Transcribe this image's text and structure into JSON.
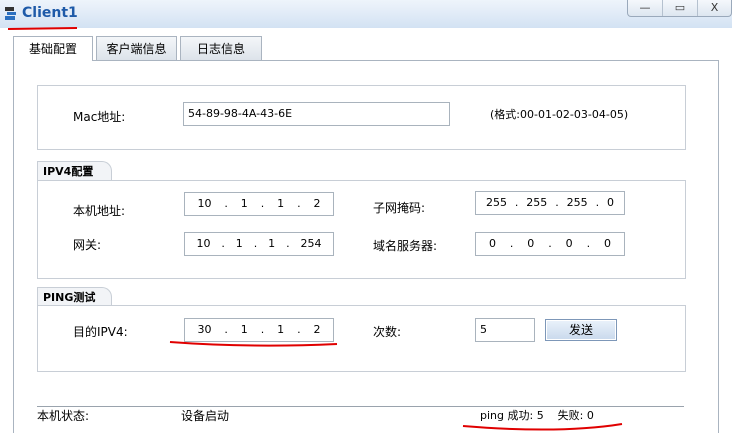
{
  "window": {
    "title": "Client1",
    "controls": {
      "minimize": "—",
      "maximize": "▭",
      "close": "X"
    }
  },
  "tabs": [
    {
      "label": "基础配置",
      "active": true
    },
    {
      "label": "客户端信息"
    },
    {
      "label": "日志信息"
    }
  ],
  "mac": {
    "label": "Mac地址:",
    "value": "54-89-98-4A-43-6E",
    "hint": "(格式:00-01-02-03-04-05)"
  },
  "ipv4": {
    "title": "IPV4配置",
    "local_label": "本机地址:",
    "local": [
      "10",
      "1",
      "1",
      "2"
    ],
    "mask_label": "子网掩码:",
    "mask": [
      "255",
      "255",
      "255",
      "0"
    ],
    "gw_label": "网关:",
    "gw": [
      "10",
      "1",
      "1",
      "254"
    ],
    "dns_label": "域名服务器:",
    "dns": [
      "0",
      "0",
      "0",
      "0"
    ]
  },
  "ping": {
    "title": "PING测试",
    "dest_label": "目的IPV4:",
    "dest": [
      "30",
      "1",
      "1",
      "2"
    ],
    "count_label": "次数:",
    "count": "5",
    "send_label": "发送"
  },
  "status": {
    "label": "本机状态:",
    "value": "设备启动",
    "result": "ping 成功: 5    失败: 0"
  },
  "colors": {
    "title": "#1e5aa8",
    "annotation": "#e00000"
  }
}
